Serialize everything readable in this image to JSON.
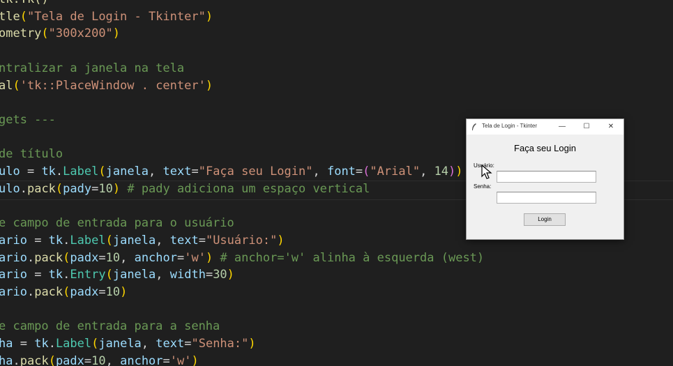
{
  "editor": {
    "lines": [
      [
        {
          "t": "tk.Tk()",
          "c": "fn"
        }
      ],
      [
        {
          "t": "tle",
          "c": "fn"
        },
        {
          "t": "(",
          "c": "paren"
        },
        {
          "t": "\"Tela de Login - Tkinter\"",
          "c": "str"
        },
        {
          "t": ")",
          "c": "paren"
        }
      ],
      [
        {
          "t": "ometry",
          "c": "fn"
        },
        {
          "t": "(",
          "c": "paren"
        },
        {
          "t": "\"300x200\"",
          "c": "str"
        },
        {
          "t": ")",
          "c": "paren"
        }
      ],
      [],
      [
        {
          "t": "ntralizar a janela na tela",
          "c": "cmt"
        }
      ],
      [
        {
          "t": "al",
          "c": "fn"
        },
        {
          "t": "(",
          "c": "paren"
        },
        {
          "t": "'tk::PlaceWindow . center'",
          "c": "str"
        },
        {
          "t": ")",
          "c": "paren"
        }
      ],
      [],
      [
        {
          "t": "gets ---",
          "c": "cmt"
        }
      ],
      [],
      [
        {
          "t": "de título",
          "c": "cmt"
        }
      ],
      [
        {
          "t": "ulo",
          "c": "var"
        },
        {
          "t": " = ",
          "c": "op"
        },
        {
          "t": "tk",
          "c": "var"
        },
        {
          "t": ".",
          "c": "op"
        },
        {
          "t": "Label",
          "c": "cls"
        },
        {
          "t": "(",
          "c": "paren"
        },
        {
          "t": "janela",
          "c": "var"
        },
        {
          "t": ", ",
          "c": "op"
        },
        {
          "t": "text",
          "c": "var"
        },
        {
          "t": "=",
          "c": "op"
        },
        {
          "t": "\"Faça seu Login\"",
          "c": "str"
        },
        {
          "t": ", ",
          "c": "op"
        },
        {
          "t": "font",
          "c": "var"
        },
        {
          "t": "=",
          "c": "op"
        },
        {
          "t": "(",
          "c": "paren2"
        },
        {
          "t": "\"Arial\"",
          "c": "str"
        },
        {
          "t": ", ",
          "c": "op"
        },
        {
          "t": "14",
          "c": "num"
        },
        {
          "t": ")",
          "c": "paren2"
        },
        {
          "t": ")",
          "c": "paren"
        }
      ],
      [
        {
          "t": "ulo",
          "c": "var"
        },
        {
          "t": ".",
          "c": "op"
        },
        {
          "t": "pack",
          "c": "fn"
        },
        {
          "t": "(",
          "c": "paren"
        },
        {
          "t": "pady",
          "c": "var"
        },
        {
          "t": "=",
          "c": "op"
        },
        {
          "t": "10",
          "c": "num"
        },
        {
          "t": ")",
          "c": "paren"
        },
        {
          "t": " # pady adiciona um espaço vertical",
          "c": "cmt"
        }
      ],
      [],
      [
        {
          "t": "e campo de entrada para o usuário",
          "c": "cmt"
        }
      ],
      [
        {
          "t": "ario",
          "c": "var"
        },
        {
          "t": " = ",
          "c": "op"
        },
        {
          "t": "tk",
          "c": "var"
        },
        {
          "t": ".",
          "c": "op"
        },
        {
          "t": "Label",
          "c": "cls"
        },
        {
          "t": "(",
          "c": "paren"
        },
        {
          "t": "janela",
          "c": "var"
        },
        {
          "t": ", ",
          "c": "op"
        },
        {
          "t": "text",
          "c": "var"
        },
        {
          "t": "=",
          "c": "op"
        },
        {
          "t": "\"Usuário:\"",
          "c": "str"
        },
        {
          "t": ")",
          "c": "paren"
        }
      ],
      [
        {
          "t": "ario",
          "c": "var"
        },
        {
          "t": ".",
          "c": "op"
        },
        {
          "t": "pack",
          "c": "fn"
        },
        {
          "t": "(",
          "c": "paren"
        },
        {
          "t": "padx",
          "c": "var"
        },
        {
          "t": "=",
          "c": "op"
        },
        {
          "t": "10",
          "c": "num"
        },
        {
          "t": ", ",
          "c": "op"
        },
        {
          "t": "anchor",
          "c": "var"
        },
        {
          "t": "=",
          "c": "op"
        },
        {
          "t": "'w'",
          "c": "str"
        },
        {
          "t": ")",
          "c": "paren"
        },
        {
          "t": " # anchor='w' alinha à esquerda (west)",
          "c": "cmt"
        }
      ],
      [
        {
          "t": "ario",
          "c": "var"
        },
        {
          "t": " = ",
          "c": "op"
        },
        {
          "t": "tk",
          "c": "var"
        },
        {
          "t": ".",
          "c": "op"
        },
        {
          "t": "Entry",
          "c": "cls"
        },
        {
          "t": "(",
          "c": "paren"
        },
        {
          "t": "janela",
          "c": "var"
        },
        {
          "t": ", ",
          "c": "op"
        },
        {
          "t": "width",
          "c": "var"
        },
        {
          "t": "=",
          "c": "op"
        },
        {
          "t": "30",
          "c": "num"
        },
        {
          "t": ")",
          "c": "paren"
        }
      ],
      [
        {
          "t": "ario",
          "c": "var"
        },
        {
          "t": ".",
          "c": "op"
        },
        {
          "t": "pack",
          "c": "fn"
        },
        {
          "t": "(",
          "c": "paren"
        },
        {
          "t": "padx",
          "c": "var"
        },
        {
          "t": "=",
          "c": "op"
        },
        {
          "t": "10",
          "c": "num"
        },
        {
          "t": ")",
          "c": "paren"
        }
      ],
      [],
      [
        {
          "t": "e campo de entrada para a senha",
          "c": "cmt"
        }
      ],
      [
        {
          "t": "ha",
          "c": "var"
        },
        {
          "t": " = ",
          "c": "op"
        },
        {
          "t": "tk",
          "c": "var"
        },
        {
          "t": ".",
          "c": "op"
        },
        {
          "t": "Label",
          "c": "cls"
        },
        {
          "t": "(",
          "c": "paren"
        },
        {
          "t": "janela",
          "c": "var"
        },
        {
          "t": ", ",
          "c": "op"
        },
        {
          "t": "text",
          "c": "var"
        },
        {
          "t": "=",
          "c": "op"
        },
        {
          "t": "\"Senha:\"",
          "c": "str"
        },
        {
          "t": ")",
          "c": "paren"
        }
      ],
      [
        {
          "t": "ha",
          "c": "var"
        },
        {
          "t": ".",
          "c": "op"
        },
        {
          "t": "pack",
          "c": "fn"
        },
        {
          "t": "(",
          "c": "paren"
        },
        {
          "t": "padx",
          "c": "var"
        },
        {
          "t": "=",
          "c": "op"
        },
        {
          "t": "10",
          "c": "num"
        },
        {
          "t": ", ",
          "c": "op"
        },
        {
          "t": "anchor",
          "c": "var"
        },
        {
          "t": "=",
          "c": "op"
        },
        {
          "t": "'w'",
          "c": "str"
        },
        {
          "t": ")",
          "c": "paren"
        }
      ]
    ]
  },
  "tk_window": {
    "title": "Tela de Login - Tkinter",
    "minimize_icon": "—",
    "maximize_icon": "☐",
    "close_icon": "✕",
    "heading": "Faça seu Login",
    "user_label": "Usuário:",
    "user_value": "",
    "password_label": "Senha:",
    "password_value": "",
    "login_button": "Login"
  }
}
